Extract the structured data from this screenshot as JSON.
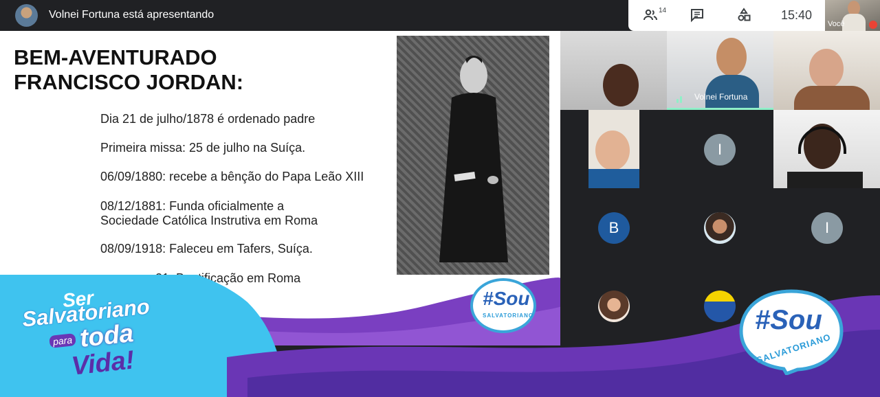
{
  "header": {
    "presenter_text": "Volnei Fortuna está apresentando",
    "participant_count": "14",
    "time": "15:40",
    "self_label": "Você",
    "icons": [
      "people-icon",
      "chat-icon",
      "activities-icon",
      "mic-off-icon"
    ]
  },
  "slide": {
    "title_line1": "BEM-AVENTURADO",
    "title_line2": "FRANCISCO JORDAN:",
    "lines": [
      "Dia 21 de julho/1878 é ordenado padre",
      "Primeira missa: 25 de julho na Suíça.",
      "06/09/1880: recebe a bênção do Papa Leão XIII",
      "08/12/1881: Funda oficialmente a",
      "Sociedade Católica Instrutiva em Roma",
      "08/09/1918: Faleceu em Tafers, Suíça.",
      "21: Beatificação em Roma"
    ],
    "badge_main": "#Sou",
    "badge_sub": "SALVATORIANO"
  },
  "participants": {
    "speaker_name": "Volnei Fortuna",
    "initials": [
      "I",
      "B",
      "I"
    ]
  },
  "branding": {
    "line1": "Ser",
    "line2": "Salvatoriano",
    "line3": "para",
    "line4": "toda",
    "line5": "Vida!",
    "badge_main": "#Sou",
    "badge_sub": "SALVATORIANO"
  },
  "colors": {
    "meet_dark": "#202124",
    "end_call": "#ea4335",
    "active_green": "#8ff0c8",
    "brand_blue": "#2a62b8",
    "brand_cyan": "#3fc3ef",
    "brand_purple": "#6a36b5"
  }
}
